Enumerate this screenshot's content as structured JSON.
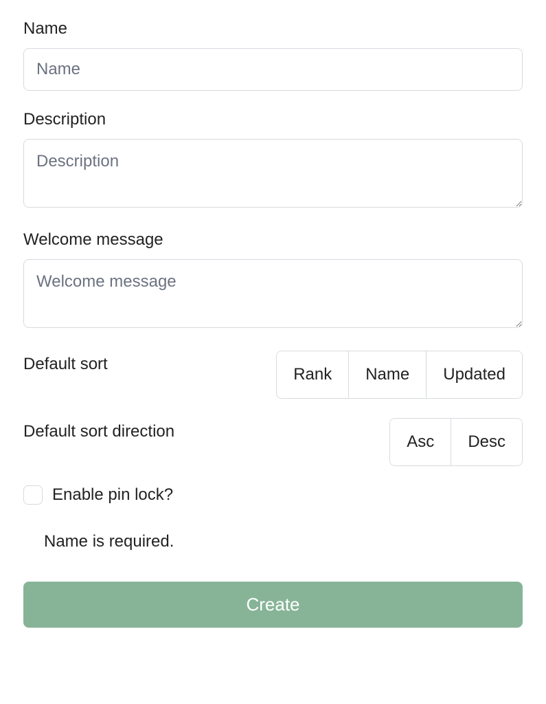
{
  "fields": {
    "name": {
      "label": "Name",
      "placeholder": "Name",
      "value": ""
    },
    "description": {
      "label": "Description",
      "placeholder": "Description",
      "value": ""
    },
    "welcome_message": {
      "label": "Welcome message",
      "placeholder": "Welcome message",
      "value": ""
    },
    "default_sort": {
      "label": "Default sort",
      "options": [
        "Rank",
        "Name",
        "Updated"
      ]
    },
    "default_sort_direction": {
      "label": "Default sort direction",
      "options": [
        "Asc",
        "Desc"
      ]
    },
    "enable_pin_lock": {
      "label": "Enable pin lock?",
      "checked": false
    }
  },
  "validation": {
    "message": "Name is required."
  },
  "actions": {
    "create": "Create"
  }
}
